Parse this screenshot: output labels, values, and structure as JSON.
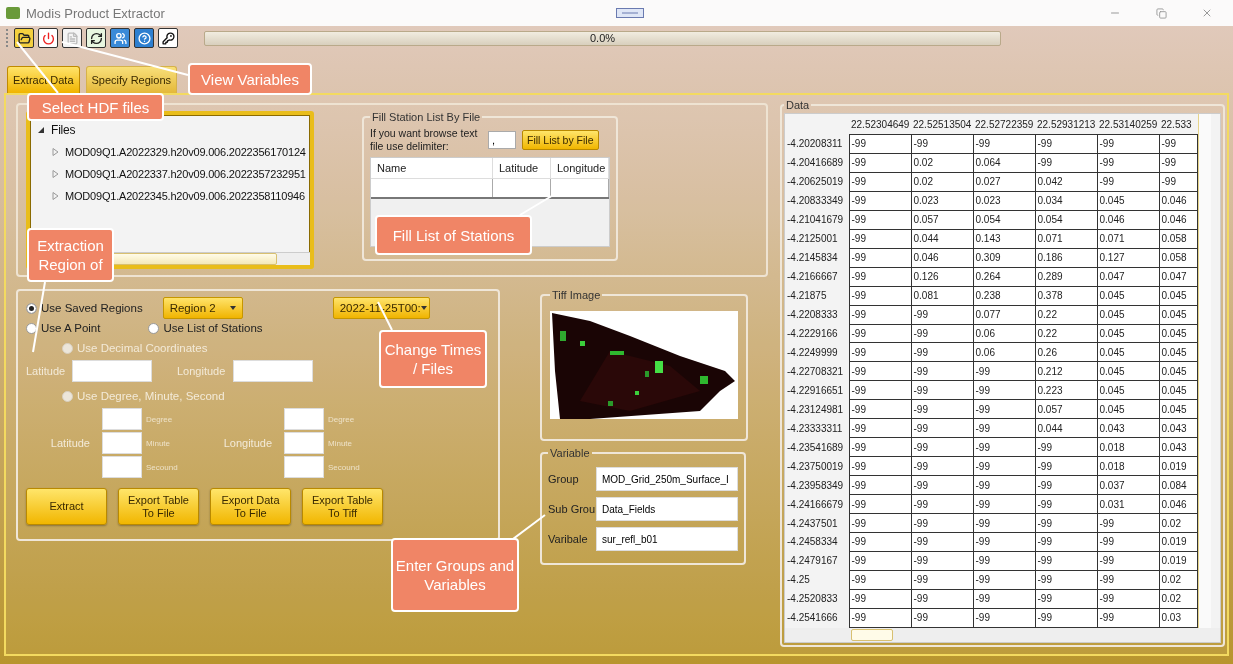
{
  "window": {
    "title": "Modis Product Extractor"
  },
  "progress": {
    "level": 0,
    "label": "0.0%"
  },
  "tabs": [
    {
      "label": "Extract Data",
      "selected": true
    },
    {
      "label": "Specify Regions",
      "selected": false
    }
  ],
  "files_tree": {
    "label": "Files",
    "expanded": true,
    "children": [
      {
        "label": "MOD09Q1.A2022329.h20v09.006.2022356170124",
        "expanded": false
      },
      {
        "label": "MOD09Q1.A2022337.h20v09.006.2022357232951",
        "expanded": false
      },
      {
        "label": "MOD09Q1.A2022345.h20v09.006.2022358110946",
        "expanded": false
      }
    ]
  },
  "station_file": {
    "title": "Fill Station List By File",
    "prompt": "If you want browse text file use delimiter:",
    "delimiter": ",",
    "button": "Fill List by File",
    "columns": [
      "Name",
      "Latitude",
      "Longitude"
    ]
  },
  "region": {
    "saved": {
      "label": "Use Saved Regions",
      "selected": true,
      "disabled": false
    },
    "region_select": "Region 2",
    "time_select": "2022-11-25T00:",
    "point": {
      "label": "Use A Point",
      "selected": false,
      "disabled": false
    },
    "stations": {
      "label": "Use List of Stations",
      "selected": false,
      "disabled": false
    },
    "decimal": {
      "label": "Use Decimal Coordinates",
      "selected": false,
      "disabled": true
    },
    "latitude_label": "Latitude",
    "longitude_label": "Longitude",
    "dms": {
      "label": "Use Degree, Minute, Second",
      "selected": false,
      "disabled": true
    },
    "dms_latitude_label": "Latitude",
    "dms_longitude_label": "Longitude",
    "dms_latitude_units": [
      "Degree",
      "Minute",
      "Secound"
    ],
    "dms_longitude_units": [
      "Degree",
      "Minute",
      "Secound"
    ],
    "buttons": [
      "Extract",
      "Export Table To File",
      "Export Data To File",
      "Export Table To Tiff"
    ]
  },
  "tiff": {
    "title": "Tiff Image"
  },
  "variable": {
    "title": "Variable",
    "fields": [
      {
        "label": "Group",
        "value": "MOD_Grid_250m_Surface_I"
      },
      {
        "label": "Sub Grou|",
        "value": "Data_Fields"
      },
      {
        "label": "Varibale",
        "value": "sur_refl_b01"
      }
    ]
  },
  "data": {
    "title": "Data",
    "columns": [
      "",
      "22.52304649",
      "22.52513504",
      "22.52722359",
      "22.52931213",
      "22.53140259",
      "22.533"
    ],
    "rows": [
      [
        "-4.20208311",
        "-99",
        "-99",
        "-99",
        "-99",
        "-99",
        "-99"
      ],
      [
        "-4.20416689",
        "-99",
        "0.02",
        "0.064",
        "-99",
        "-99",
        "-99"
      ],
      [
        "-4.20625019",
        "-99",
        "0.02",
        "0.027",
        "0.042",
        "-99",
        "-99"
      ],
      [
        "-4.20833349",
        "-99",
        "0.023",
        "0.023",
        "0.034",
        "0.045",
        "0.046"
      ],
      [
        "-4.21041679",
        "-99",
        "0.057",
        "0.054",
        "0.054",
        "0.046",
        "0.046"
      ],
      [
        "-4.2125001",
        "-99",
        "0.044",
        "0.143",
        "0.071",
        "0.071",
        "0.058"
      ],
      [
        "-4.2145834",
        "-99",
        "0.046",
        "0.309",
        "0.186",
        "0.127",
        "0.058"
      ],
      [
        "-4.2166667",
        "-99",
        "0.126",
        "0.264",
        "0.289",
        "0.047",
        "0.047"
      ],
      [
        "-4.21875",
        "-99",
        "0.081",
        "0.238",
        "0.378",
        "0.045",
        "0.045"
      ],
      [
        "-4.2208333",
        "-99",
        "-99",
        "0.077",
        "0.22",
        "0.045",
        "0.045"
      ],
      [
        "-4.2229166",
        "-99",
        "-99",
        "0.06",
        "0.22",
        "0.045",
        "0.045"
      ],
      [
        "-4.2249999",
        "-99",
        "-99",
        "0.06",
        "0.26",
        "0.045",
        "0.045"
      ],
      [
        "-4.22708321",
        "-99",
        "-99",
        "-99",
        "0.212",
        "0.045",
        "0.045"
      ],
      [
        "-4.22916651",
        "-99",
        "-99",
        "-99",
        "0.223",
        "0.045",
        "0.045"
      ],
      [
        "-4.23124981",
        "-99",
        "-99",
        "-99",
        "0.057",
        "0.045",
        "0.045"
      ],
      [
        "-4.23333311",
        "-99",
        "-99",
        "-99",
        "0.044",
        "0.043",
        "0.043"
      ],
      [
        "-4.23541689",
        "-99",
        "-99",
        "-99",
        "-99",
        "0.018",
        "0.043"
      ],
      [
        "-4.23750019",
        "-99",
        "-99",
        "-99",
        "-99",
        "0.018",
        "0.019"
      ],
      [
        "-4.23958349",
        "-99",
        "-99",
        "-99",
        "-99",
        "0.037",
        "0.084"
      ],
      [
        "-4.24166679",
        "-99",
        "-99",
        "-99",
        "-99",
        "0.031",
        "0.046"
      ],
      [
        "-4.2437501",
        "-99",
        "-99",
        "-99",
        "-99",
        "-99",
        "0.02"
      ],
      [
        "-4.2458334",
        "-99",
        "-99",
        "-99",
        "-99",
        "-99",
        "0.019"
      ],
      [
        "-4.2479167",
        "-99",
        "-99",
        "-99",
        "-99",
        "-99",
        "0.019"
      ],
      [
        "-4.25",
        "-99",
        "-99",
        "-99",
        "-99",
        "-99",
        "0.02"
      ],
      [
        "-4.2520833",
        "-99",
        "-99",
        "-99",
        "-99",
        "-99",
        "0.02"
      ],
      [
        "-4.2541666",
        "-99",
        "-99",
        "-99",
        "-99",
        "-99",
        "0.03"
      ]
    ]
  },
  "callouts": [
    {
      "text": "Select HDF files"
    },
    {
      "text": "View Variables"
    },
    {
      "text": "Extraction Region of"
    },
    {
      "text": "Fill List of Stations"
    },
    {
      "text": "Change Times / Files"
    },
    {
      "text": "Enter Groups and Variables"
    }
  ]
}
